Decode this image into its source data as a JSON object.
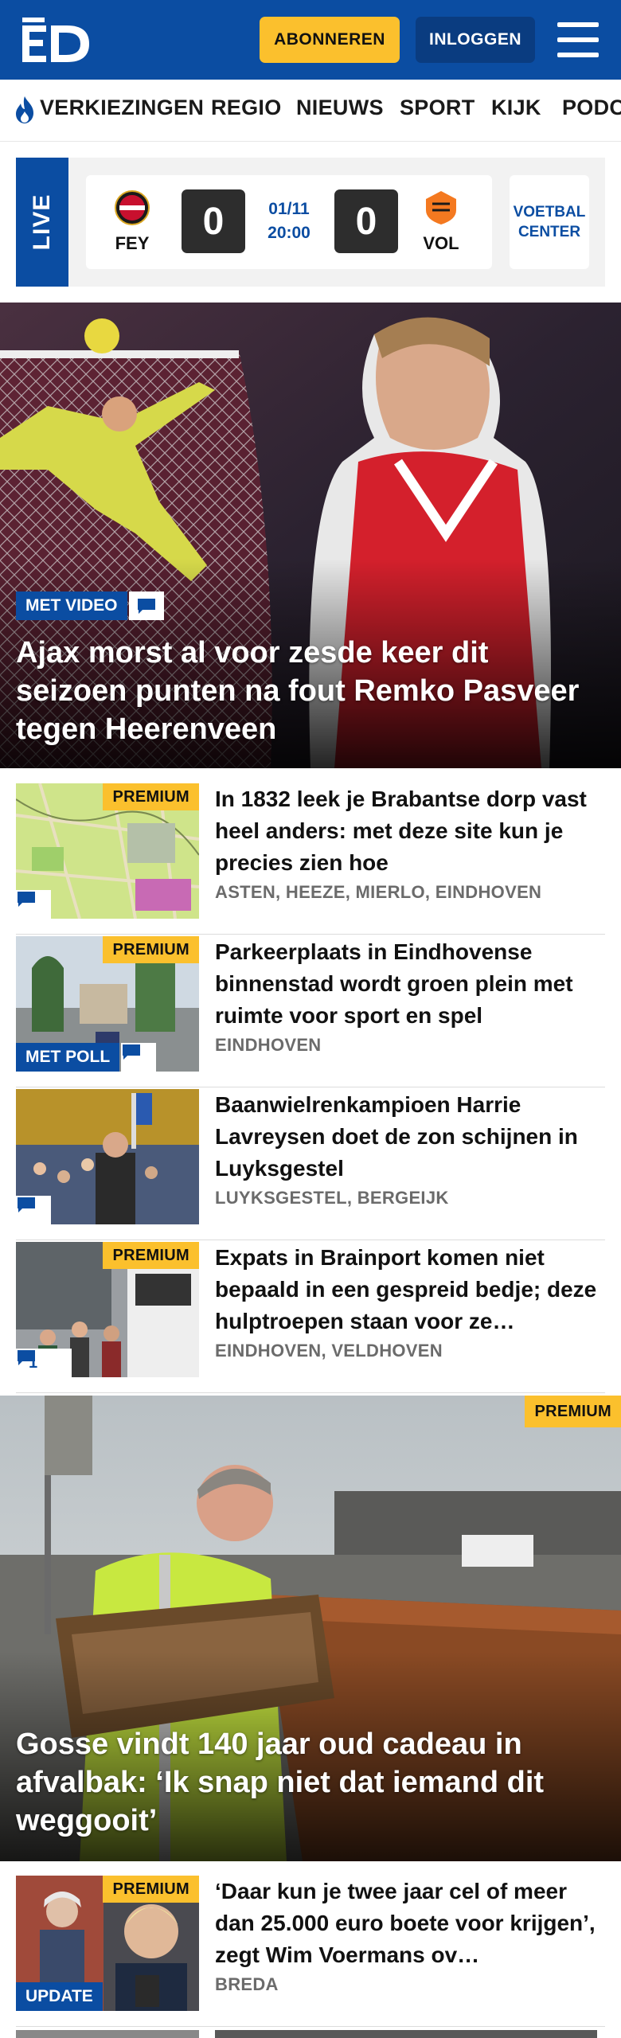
{
  "header": {
    "logo_text": "ED",
    "subscribe_label": "ABONNEREN",
    "login_label": "INLOGGEN"
  },
  "nav": {
    "items": [
      "VERKIEZINGEN",
      "REGIO",
      "NIEUWS",
      "SPORT",
      "KIJK",
      "PODCASTS"
    ]
  },
  "live": {
    "label": "LIVE",
    "home_team": "FEY",
    "away_team": "VOL",
    "home_score": "0",
    "away_score": "0",
    "date": "01/11",
    "time": "20:00",
    "voetbal_center": "VOETBAL CENTER"
  },
  "hero1": {
    "badge": "MET VIDEO",
    "title": "Ajax morst al voor zesde keer dit seizoen punten na fout Remko Pasveer tegen Heerenveen"
  },
  "articles": [
    {
      "title": "In 1832 leek je Brabantse dorp vast heel anders: met deze site kun je precies zien hoe",
      "place": "ASTEN, HEEZE, MIERLO, EINDHOVEN",
      "premium": "PREMIUM",
      "comments": ""
    },
    {
      "title": "Parkeerplaats in Eindhovense binnenstad wordt groen plein met ruimte voor sport en spel",
      "place": "EINDHOVEN",
      "premium": "PREMIUM",
      "badge": "MET POLL",
      "comments": ""
    },
    {
      "title": "Baanwielrenkampioen Harrie Lavreysen doet de zon schijnen in Luyksgestel",
      "place": "LUYKSGESTEL, BERGEIJK",
      "comments": ""
    },
    {
      "title": "Expats in Brainport komen niet bepaald in een gespreid bedje; deze hulptroepen staan voor ze…",
      "place": "EINDHOVEN, VELDHOVEN",
      "premium": "PREMIUM",
      "comments": "1"
    }
  ],
  "hero2": {
    "premium": "PREMIUM",
    "title": "Gosse vindt 140 jaar oud cadeau in afvalbak: ‘Ik snap niet dat iemand dit weggooit’"
  },
  "article5": {
    "title": "‘Daar kun je twee jaar cel of meer dan 25.000 euro boete voor krijgen’, zegt Wim Voermans ov…",
    "place": "BREDA",
    "premium": "PREMIUM",
    "badge": "UPDATE"
  },
  "colors": {
    "brand_blue": "#0b4da2",
    "premium_yellow": "#fbc02d"
  }
}
